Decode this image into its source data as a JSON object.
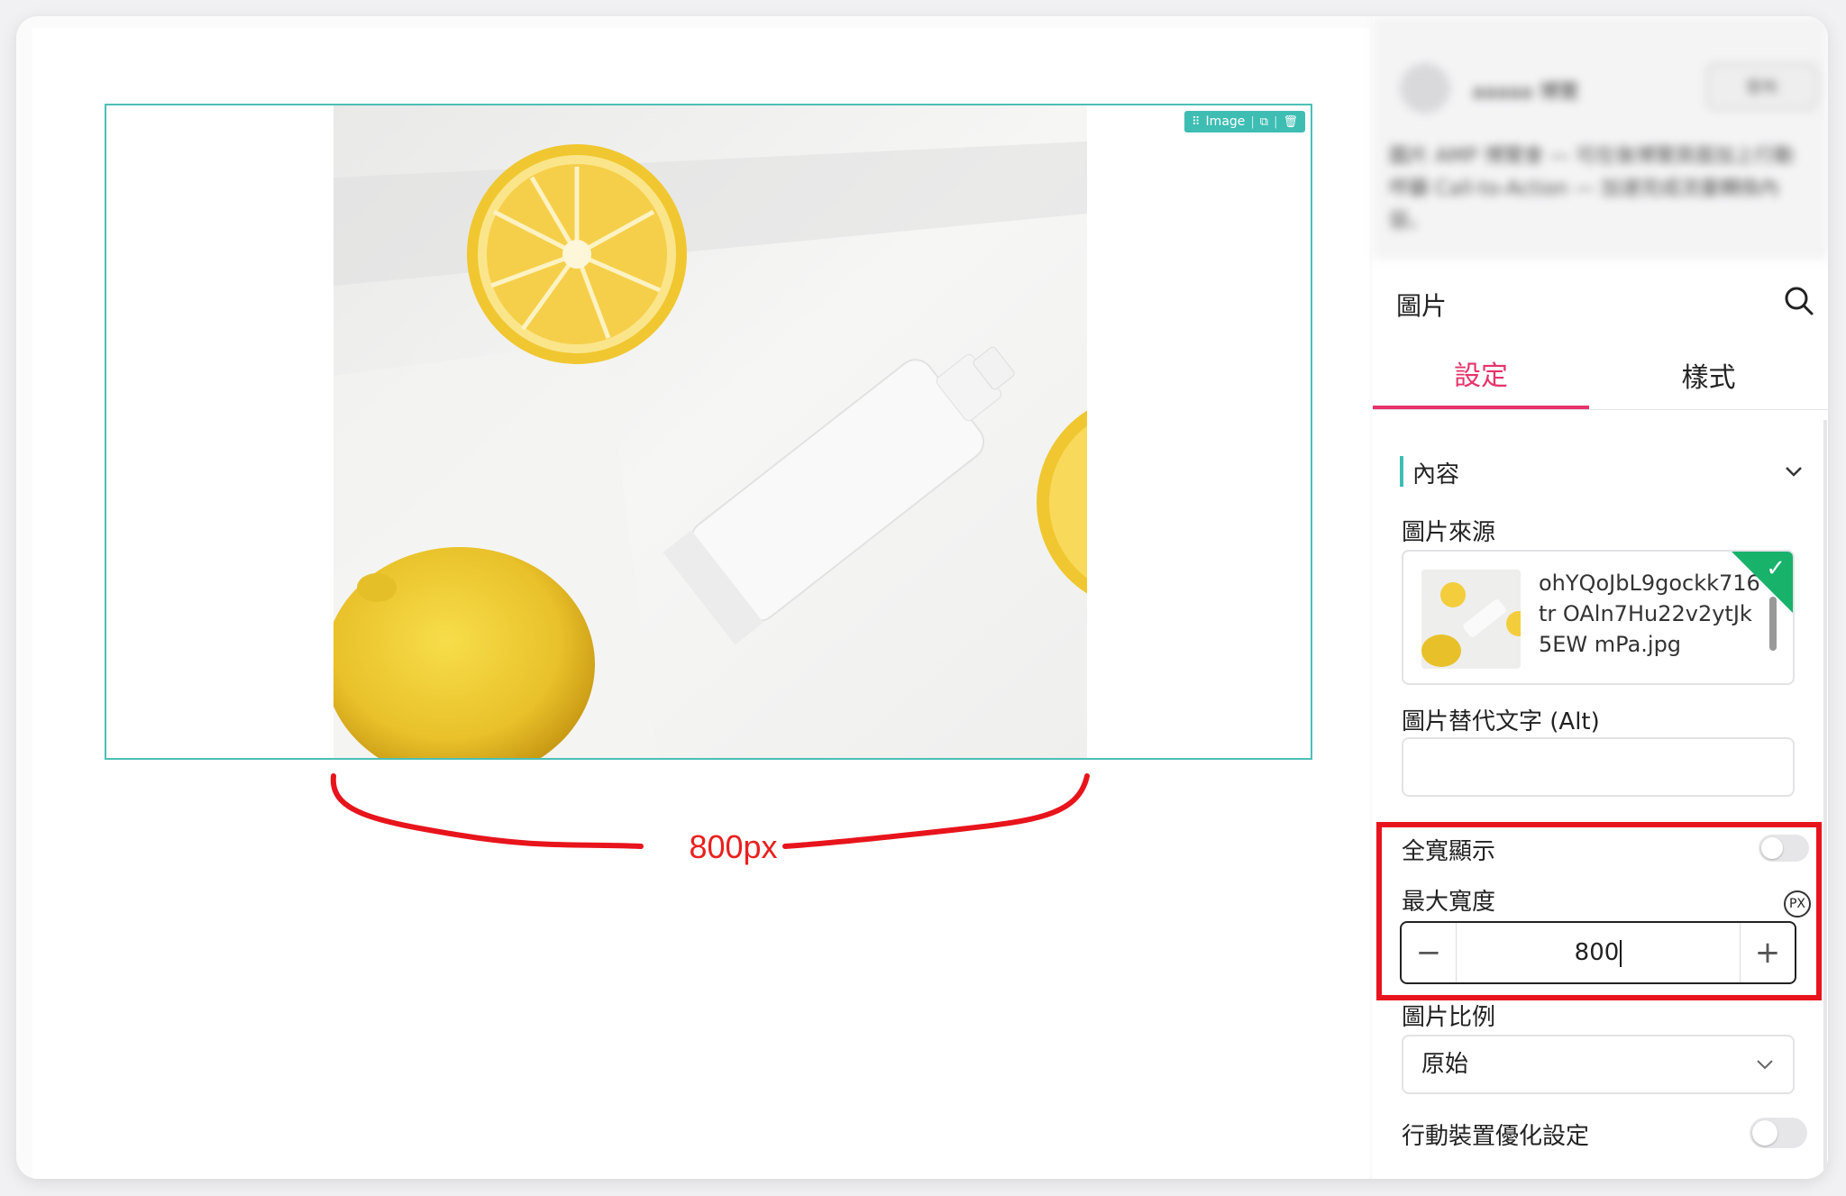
{
  "canvas": {
    "image_block": {
      "toolbar_label": "Image",
      "toolbar_icons": [
        "drag-handle-icon",
        "duplicate-icon",
        "delete-icon"
      ]
    },
    "annotation_label": "800px"
  },
  "panel": {
    "header_blurred": {
      "name": "aaaaa 博覽",
      "button_label": "發布",
      "description": "圖片 AMP 博覽會 — 可在後博覽頁面加上行動呼籲 Call-to-Action — 加速完成流量轉換內容。"
    },
    "title": "圖片",
    "tabs": [
      {
        "label": "設定",
        "active": true
      },
      {
        "label": "樣式",
        "active": false
      }
    ],
    "section_title": "內容",
    "image_source_label": "圖片來源",
    "image_source_filename": "ohYQoJbL9gockk716tr OAln7Hu22v2ytJk5EW mPa.jpg",
    "alt_label": "圖片替代文字 (Alt)",
    "alt_value": "",
    "full_width_label": "全寬顯示",
    "full_width_on": false,
    "max_width_label": "最大寬度",
    "max_width_unit": "PX",
    "max_width_value": "800",
    "stepper_minus": "−",
    "stepper_plus": "+",
    "ratio_label": "圖片比例",
    "ratio_value": "原始",
    "mobile_label": "行動裝置優化設定",
    "mobile_on": false
  },
  "colors": {
    "accent_teal": "#3ebdb3",
    "tab_active": "#e6336a",
    "highlight_red": "#e8141c",
    "check_green": "#18b26b"
  }
}
